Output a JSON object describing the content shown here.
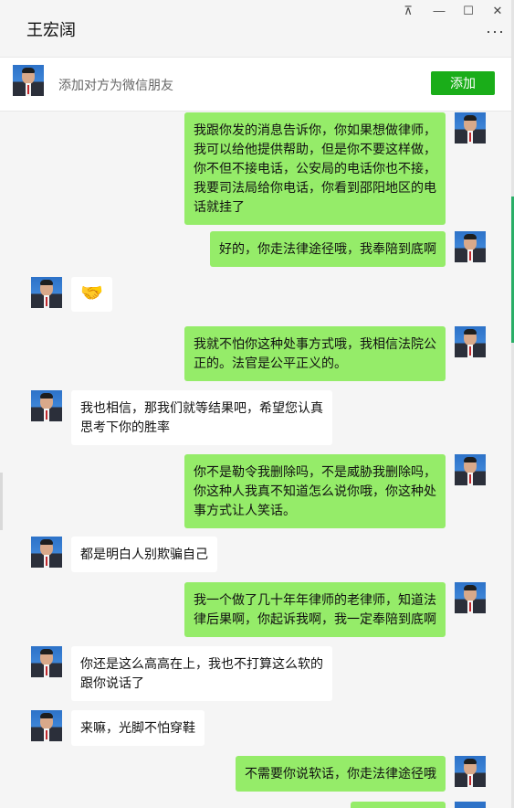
{
  "window": {
    "title": "王宏阔",
    "pin": "⊼",
    "minimize": "—",
    "maximize": "☐",
    "close": "✕",
    "more": "···"
  },
  "banner": {
    "text": "添加对方为微信朋友",
    "button": "添加"
  },
  "messages": [
    {
      "side": "mine",
      "text": "我跟你发的消息告诉你，你如果想做律师，我可以给他提供帮助，但是你不要这样做，你不但不接电话，公安局的电话你也不接，我要司法局给你电话，你看到邵阳地区的电话就挂了"
    },
    {
      "side": "mine",
      "text": "好的，你走法律途径哦，我奉陪到底啊"
    },
    {
      "side": "theirs",
      "text": "🤝"
    },
    {
      "side": "mine",
      "text": "我就不怕你这种处事方式哦，我相信法院公正的。法官是公平正义的。"
    },
    {
      "side": "theirs",
      "text": "我也相信，那我们就等结果吧，希望您认真思考下你的胜率"
    },
    {
      "side": "mine",
      "text": "你不是勒令我删除吗，不是威胁我删除吗，你这种人我真不知道怎么说你哦，你这种处事方式让人笑话。"
    },
    {
      "side": "theirs",
      "text": "都是明白人别欺骗自己"
    },
    {
      "side": "mine",
      "text": "我一个做了几十年年律师的老律师，知道法律后果啊，你起诉我啊，我一定奉陪到底啊"
    },
    {
      "side": "theirs",
      "text": "你还是这么高高在上，我也不打算这么软的跟你说话了"
    },
    {
      "side": "theirs",
      "text": "来嘛，光脚不怕穿鞋"
    },
    {
      "side": "mine",
      "text": "不需要你说软话，你走法律途径哦"
    }
  ]
}
